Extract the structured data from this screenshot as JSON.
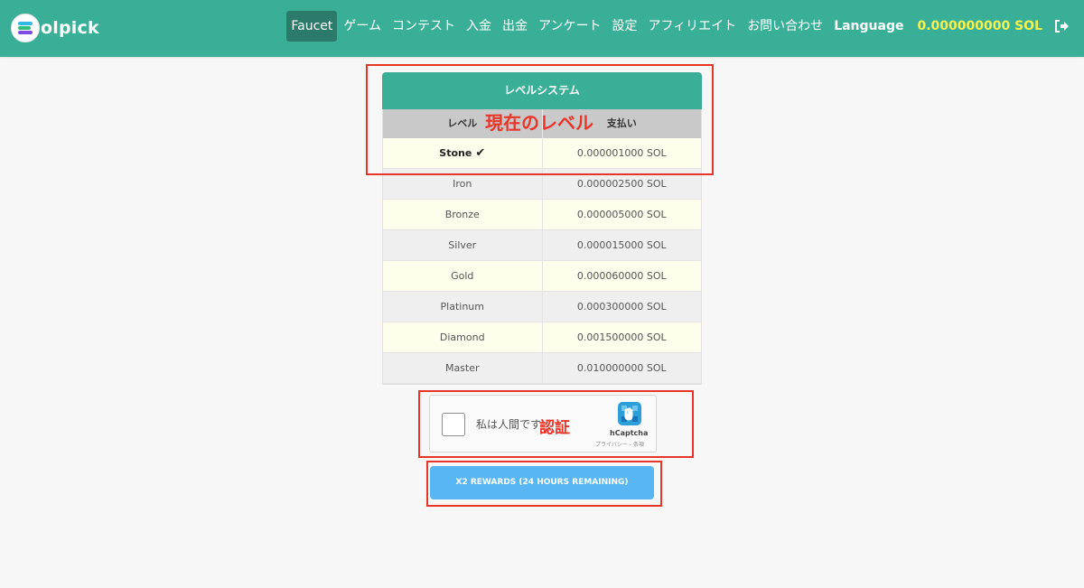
{
  "brand": {
    "logo_text": "olpick"
  },
  "nav": {
    "items": [
      "Faucet",
      "ゲーム",
      "コンテスト",
      "入金",
      "出金",
      "アンケート",
      "設定",
      "アフィリエイト",
      "お問い合わせ"
    ],
    "language": "Language",
    "balance": "0.000000000 SOL",
    "logout_icon": "sign-out-icon"
  },
  "level_table": {
    "title": "レベルシステム",
    "col_level": "レベル",
    "col_payment": "支払い",
    "rows": [
      {
        "level": "Stone",
        "payment": "0.000001000 SOL",
        "current": true
      },
      {
        "level": "Iron",
        "payment": "0.000002500 SOL"
      },
      {
        "level": "Bronze",
        "payment": "0.000005000 SOL"
      },
      {
        "level": "Silver",
        "payment": "0.000015000 SOL"
      },
      {
        "level": "Gold",
        "payment": "0.000060000 SOL"
      },
      {
        "level": "Platinum",
        "payment": "0.000300000 SOL"
      },
      {
        "level": "Diamond",
        "payment": "0.001500000 SOL"
      },
      {
        "level": "Master",
        "payment": "0.010000000 SOL"
      }
    ]
  },
  "annotations": {
    "current_level": "現在のレベル",
    "verify": "認証"
  },
  "captcha": {
    "label": "私は人間です",
    "brand": "hCaptcha",
    "links": "プライバシー - 条項"
  },
  "reward_button": {
    "label": "X2 REWARDS (24 HOURS REMAINING)"
  },
  "colors": {
    "navbar": "#3aaf98",
    "active_nav": "#2c7a69",
    "balance": "#f4f250",
    "annotation": "#e8352a",
    "reward_button": "#57b6f3"
  }
}
